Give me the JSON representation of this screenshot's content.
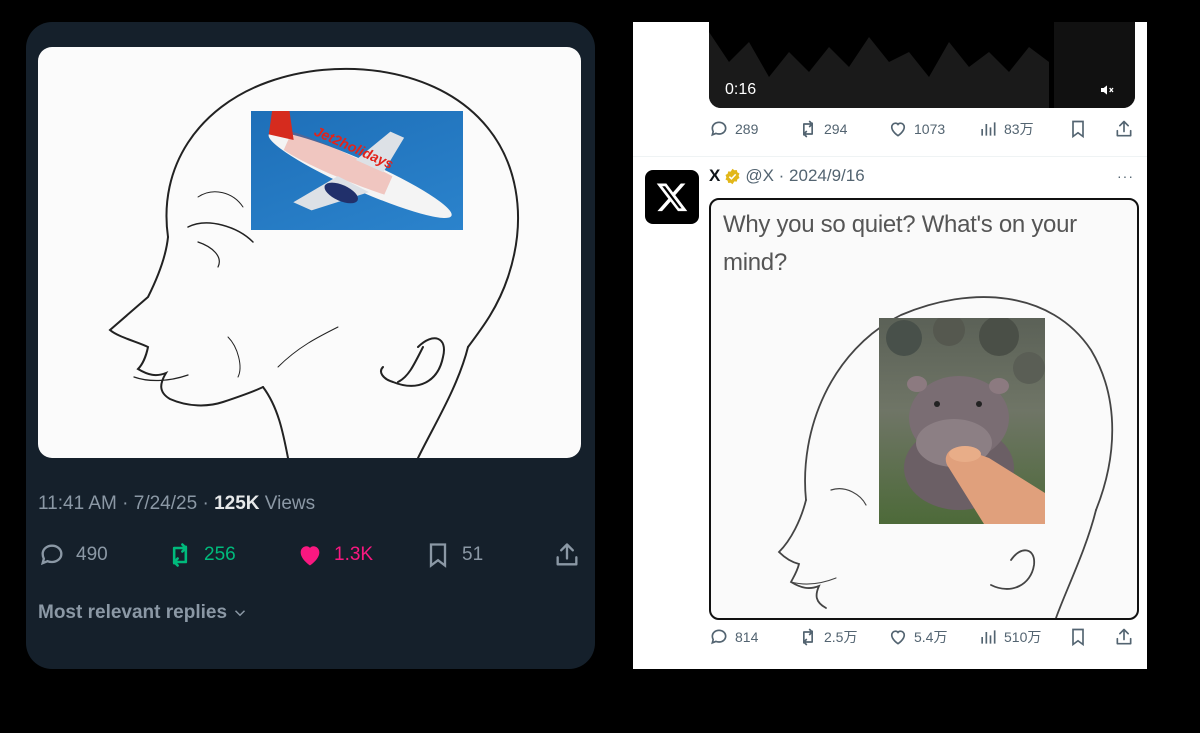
{
  "left_post": {
    "image": {
      "inset_brand_text": "Jet2holidays"
    },
    "time": "11:41 AM",
    "date": "7/24/25",
    "views_count": "125K",
    "views_label": "Views",
    "stats": {
      "replies": "490",
      "reposts": "256",
      "likes": "1.3K",
      "bookmarks": "51"
    },
    "replies_sort_label": "Most relevant replies"
  },
  "right_screenshot": {
    "video_time": "0:16",
    "top_stats": {
      "replies": "289",
      "reposts": "294",
      "likes": "1073",
      "views": "83万"
    },
    "post": {
      "name": "X",
      "handle_date": "@X · 2024/9/16",
      "more": "···",
      "meme_text": "Why you so quiet? What's on your mind?"
    },
    "bottom_stats": {
      "replies": "814",
      "reposts": "2.5万",
      "likes": "5.4万",
      "views": "510万"
    }
  },
  "colors": {
    "dark_bg": "#15202b",
    "repost_green": "#00ba7c",
    "like_pink": "#f91880",
    "muted_gray": "#8b98a5",
    "verified_gold": "#e2b719"
  }
}
